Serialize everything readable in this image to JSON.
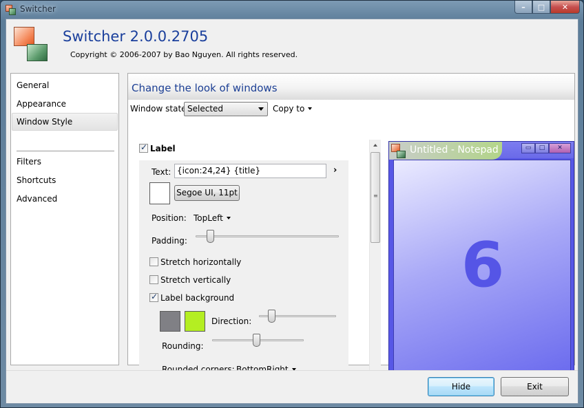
{
  "window": {
    "title": "Switcher",
    "controls": [
      "–",
      "□",
      "✕"
    ]
  },
  "header": {
    "app_title": "Switcher 2.0.0.2705",
    "copyright": "Copyright © 2006-2007 by Bao Nguyen. All rights reserved."
  },
  "nav": {
    "items": [
      {
        "label": "General"
      },
      {
        "label": "Appearance"
      },
      {
        "label": "Window Style",
        "selected": true
      },
      {
        "label": "Filters"
      },
      {
        "label": "Shortcuts"
      },
      {
        "label": "Advanced"
      }
    ]
  },
  "main": {
    "heading": "Change the look of windows",
    "window_state_label": "Window state:",
    "window_state_value": "Selected",
    "copy_to_label": "Copy to"
  },
  "settings": {
    "label_checkbox": "Label",
    "label_checked": true,
    "text_label": "Text:",
    "text_value": "{icon:24,24} {title}",
    "font_button": "Segoe UI, 11pt",
    "position_label": "Position:",
    "position_value": "TopLeft",
    "padding_label": "Padding:",
    "padding_level": 0.1,
    "stretch_horizontally": "Stretch horizontally",
    "stretch_vertically": "Stretch vertically",
    "label_background": "Label background",
    "label_background_checked": true,
    "direction_label": "Direction:",
    "direction_level": 0.15,
    "rounding_label": "Rounding:",
    "rounding_level": 0.5,
    "rounded_corners_label": "Rounded corners:",
    "rounded_corners_value": "BottomRight",
    "colors": {
      "font_color": "#ffffff",
      "bg_start": "#808085",
      "bg_end": "#b4ee22"
    }
  },
  "preview": {
    "title": "Untitled - Notepad",
    "number": "6",
    "colors": {
      "window": "#5757e6",
      "number": "#5555e6"
    }
  },
  "footer": {
    "hide_label": "Hide",
    "exit_label": "Exit"
  }
}
